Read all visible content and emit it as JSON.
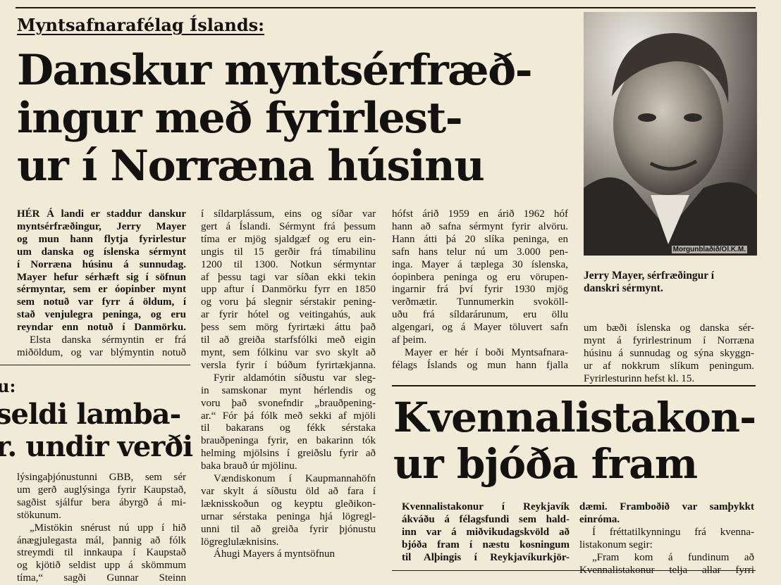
{
  "article1": {
    "kicker": "Myntsafnarafélag Íslands:",
    "headline_lines": [
      "Danskur myntsérfræð-",
      "ingur með fyrirlest-",
      "ur í Norræna húsinu"
    ],
    "col1": {
      "lead_lines": [
        "HÉR Á landi er staddur danskur",
        "myntsérfræðingur, Jerry Mayer",
        "og mun hann flytja fyrirlestur",
        "um danska og íslenska sérmynt",
        "í Norræna húsinu á sunnudag.",
        "Mayer hefur sérhæft sig í söfnun",
        "sérmyntar, sem er óopinber mynt",
        "sem notuð var fyrr á öldum, í",
        "stað venjulegra peninga, og eru",
        "reyndar enn notuð í Danmörku."
      ],
      "body_lines": [
        "Elsta danska sérmyntin er frá",
        "miðöldum, og var blýmyntin notuð"
      ]
    },
    "col2": {
      "lines": [
        "í síldarplássum, eins og síðar var",
        "gert á Íslandi. Sérmynt frá þessum",
        "tíma er mjög sjaldgæf og eru ein-",
        "ungis til 15 gerðir frá tímabilinu",
        "1200 til 1300. Notkun sérmyntar",
        "af þessu tagi var síðan ekki tekin",
        "upp aftur í Danmörku fyrr en 1850",
        "og voru þá slegnir sérstakir pening-",
        "ar fyrir hótel og veitingahús, auk",
        "þess sem mörg fyrirtæki áttu það",
        "til að greiða starfsfólki með eigin",
        "mynt, sem fólkinu var svo skylt að",
        "versla fyrir í búðum fyrirtækjanna.",
        "Fyrir aldamótin síðustu var sleg-",
        "in samskonar mynt hérlendis og",
        "voru það svonefndir „brauðpening-",
        "ar.“ Fór þá fólk með sekki af mjöli",
        "til bakarans og fékk sérstaka",
        "brauðpeninga fyrir, en bakarinn tók",
        "helming mjölsins í greiðslu fyrir að",
        "baka brauð úr mjölinu.",
        "Vændiskonum í Kaupmannahöfn",
        "var skylt á síðustu öld að fara í",
        "læknisskoðun og keyptu gleðikon-",
        "urnar sérstaka peninga hjá lögregl-",
        "unni til að greiða fyrir þjónustu",
        "lögreglulæknisins.",
        "Áhugi Mayers á myntsöfnun"
      ]
    },
    "col3": {
      "lines": [
        "hófst árið 1959 en árið 1962 hóf",
        "hann að safna sérmynt fyrir alvöru.",
        "Hann átti þá 20 slíka peninga, en",
        "safn hans telur nú um 3.000 pen-",
        "inga. Mayer á tæplega 30 íslenska,",
        "óopinbera peninga og eru vörupen-",
        "ingarnir frá því fyrir 1930 mjög",
        "verðmætir. Tunnumerkin svoköll-",
        "uðu frá síldarárunum, eru öllu",
        "algengari, og á Mayer töluvert safn",
        "af þeim.",
        "Mayer er hér í boði Myntsafnara-",
        "félags Íslands og mun hann fjalla"
      ]
    },
    "col4": {
      "lines": [
        "um bæði íslenska og danska sér-",
        "mynt á fyrirlestrinum í Norræna",
        "húsinu á sunnudag og sýna skyggn-",
        "ur af nokkrum slíkum peningum.",
        "Fyrirlesturinn hefst kl. 15."
      ]
    },
    "photo": {
      "credit": "Morgunblaðið/Ól.K.M.",
      "caption_lines": [
        "Jerry Mayer, sérfræðingur í",
        "danskri sérmynt."
      ]
    }
  },
  "article2": {
    "kicker": "u:",
    "headline_lines": [
      "seldi lamba-",
      "r. undir verði"
    ],
    "body_lines": [
      "lýsingaþjónustunni GBB, sem sér",
      "um gerð auglýsinga fyrir Kaupstað,",
      "sagðist sjálfur bera ábyrgð á mi-",
      "stökunum.",
      "„Mistökin snérust nú upp í hið",
      "ánægjulegasta mál, þannig að fólk",
      "streymdi til innkaupa í Kaupstað",
      "og kjötið seldist upp á skömmum",
      "tíma,“ sagði Gunnar Steinn"
    ]
  },
  "article3": {
    "headline_lines": [
      "Kvennalistakon-",
      "ur bjóða fram"
    ],
    "col1_lines": [
      "Kvennalistakonur í Reykjavík",
      "ákváðu á félagsfundi sem hald-",
      "inn var á miðvikudagskvöld að",
      "bjóða fram í næstu kosningum",
      "til Alþingis í Reykjavíkurkjör-"
    ],
    "col2_lead_lines": [
      "dæmi. Framboðið var samþykkt",
      "einróma."
    ],
    "col2_body_lines": [
      "Í fréttatilkynningu frá kvenna-",
      "listakonum segir:",
      "„Fram kom á fundinum að",
      "Kvennalistakonur telja allar fyrri"
    ]
  }
}
